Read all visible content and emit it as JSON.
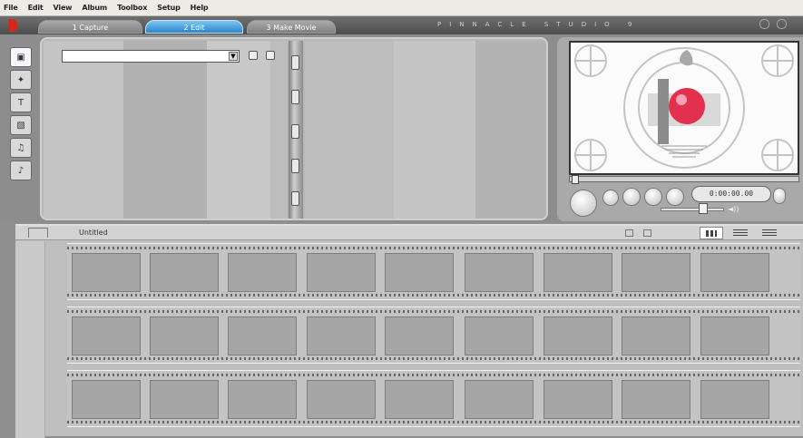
{
  "menu": [
    "File",
    "Edit",
    "View",
    "Album",
    "Toolbox",
    "Setup",
    "Help"
  ],
  "tabs": {
    "capture": "1 Capture",
    "edit": "2 Edit",
    "make_movie": "3 Make Movie"
  },
  "brand": "PINNACLE STUDIO 9",
  "album": {
    "dropdown_value": "",
    "pages": 2
  },
  "tools": [
    {
      "name": "video-scenes",
      "glyph": "▣"
    },
    {
      "name": "transitions",
      "glyph": "✦"
    },
    {
      "name": "titles",
      "glyph": "T"
    },
    {
      "name": "still-images",
      "glyph": "▧"
    },
    {
      "name": "sound-effects",
      "glyph": "♫"
    },
    {
      "name": "music",
      "glyph": "♪"
    }
  ],
  "player": {
    "timecode": "0:00:00.00",
    "volume_icon": "◄))"
  },
  "timeline": {
    "title": "Untitled"
  },
  "storyboard": {
    "rows": 3,
    "frames_per_row": 9
  },
  "colors": {
    "active_tab": "#2c85c9",
    "logo": "#d8261f",
    "test_ball": "#e2304e"
  }
}
